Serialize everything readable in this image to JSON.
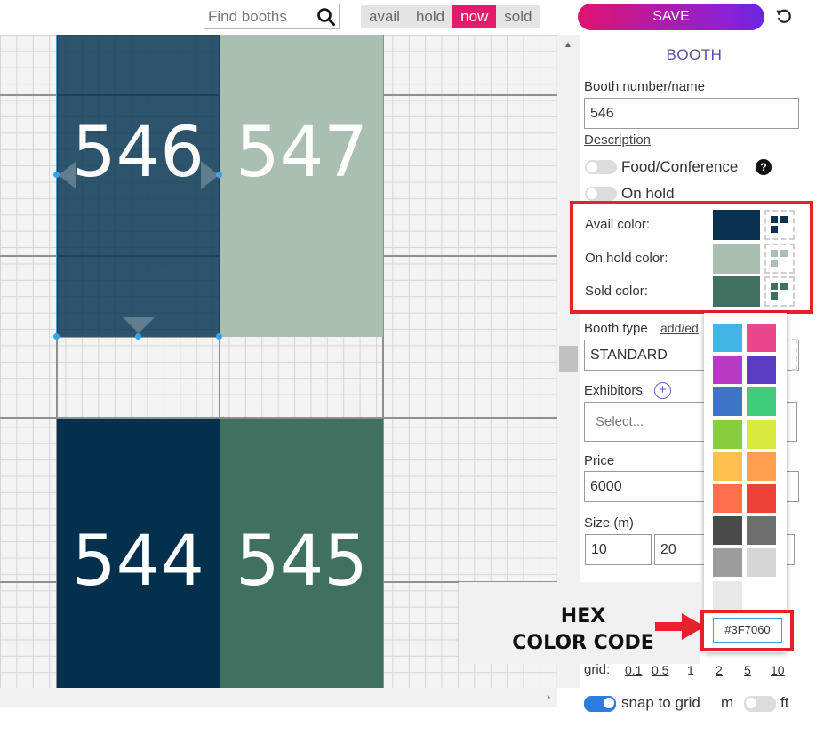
{
  "search": {
    "placeholder": "Find booths",
    "value": ""
  },
  "mode_tabs": [
    {
      "label": "avail",
      "active": false
    },
    {
      "label": "hold",
      "active": false
    },
    {
      "label": "now",
      "active": true
    },
    {
      "label": "sold",
      "active": false
    }
  ],
  "save_label": "SAVE",
  "booths": [
    {
      "number": "546",
      "color": "#02324F",
      "selected": true
    },
    {
      "number": "547",
      "color": "#AABFB2",
      "selected": false
    },
    {
      "number": "544",
      "color": "#03314D",
      "selected": false
    },
    {
      "number": "545",
      "color": "#3F7060",
      "selected": false
    }
  ],
  "panel": {
    "title": "BOOTH",
    "booth_number_label": "Booth number/name",
    "booth_number_value": "546",
    "description_link": "Description",
    "food_conference_label": "Food/Conference",
    "food_conference_on": false,
    "on_hold_label": "On hold",
    "on_hold_on": false,
    "colors": [
      {
        "label": "Avail color:",
        "color": "#06324F"
      },
      {
        "label": "On hold color:",
        "color": "#AABFB2"
      },
      {
        "label": "Sold color:",
        "color": "#3F7060"
      }
    ],
    "booth_type_label": "Booth type",
    "booth_type_link": "add/ed",
    "booth_type_value": "STANDARD",
    "exhibitors_label": "Exhibitors",
    "exhibitors_placeholder": "Select...",
    "price_label": "Price",
    "price_value": "6000",
    "size_label": "Size (m)",
    "size_w": "10",
    "size_h": "20",
    "grid_label": "grid:",
    "grid_options": [
      "0.1",
      "0.5",
      "1",
      "2",
      "5",
      "10"
    ],
    "snap_label": "snap to grid",
    "snap_on": true,
    "unit_m": "m",
    "unit_ft": "ft",
    "ft_on": false
  },
  "picker": {
    "colors": [
      "#41B6E6",
      "#E8478B",
      "#B93AC2",
      "#5A3DC2",
      "#3E73C8",
      "#3FCB7A",
      "#86CE3E",
      "#D9EA3E",
      "#FFC04E",
      "#FF9E4F",
      "#FF6F4D",
      "#EE4137",
      "#4A4A4A",
      "#6E6E6E",
      "#9C9C9C",
      "#D6D6D6",
      "#E8E8E8"
    ],
    "hex_value": "#3F7060"
  },
  "annotation": {
    "line1": "HEX",
    "line2": "COLOR CODE"
  }
}
